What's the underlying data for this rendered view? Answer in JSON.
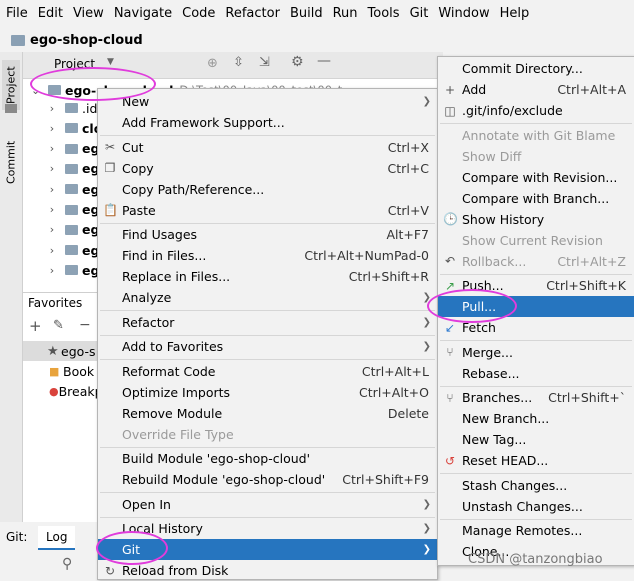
{
  "menubar": [
    "File",
    "Edit",
    "View",
    "Navigate",
    "Code",
    "Refactor",
    "Build",
    "Run",
    "Tools",
    "Git",
    "Window",
    "Help"
  ],
  "nav_title": "ego-shop-cloud",
  "left_tabs": {
    "project": "Project",
    "commit": "Commit"
  },
  "project_panel": {
    "header_label": "Project",
    "root_label": "ego-shop-cloud",
    "root_path": "D:\\Test\\00_Java\\00_test\\00_t",
    "children": [
      ".id",
      "clo",
      "eg",
      "eg",
      "eg",
      "eg",
      "eg",
      "eg",
      "eg"
    ]
  },
  "favorites": {
    "title": "Favorites",
    "items": [
      "ego-s",
      "Book",
      "Breakp"
    ]
  },
  "bottom": {
    "git_label": "Git:",
    "log_tab": "Log"
  },
  "context_menu": [
    {
      "label": "New",
      "sub": true
    },
    {
      "label": "Add Framework Support..."
    },
    {
      "sep": true
    },
    {
      "label": "Cut",
      "shortcut": "Ctrl+X",
      "icon": "scissors-icon"
    },
    {
      "label": "Copy",
      "shortcut": "Ctrl+C",
      "icon": "copy-icon"
    },
    {
      "label": "Copy Path/Reference..."
    },
    {
      "label": "Paste",
      "shortcut": "Ctrl+V",
      "icon": "paste-icon"
    },
    {
      "sep": true
    },
    {
      "label": "Find Usages",
      "shortcut": "Alt+F7"
    },
    {
      "label": "Find in Files...",
      "shortcut": "Ctrl+Alt+NumPad-0"
    },
    {
      "label": "Replace in Files...",
      "shortcut": "Ctrl+Shift+R"
    },
    {
      "label": "Analyze",
      "sub": true
    },
    {
      "sep": true
    },
    {
      "label": "Refactor",
      "sub": true
    },
    {
      "sep": true
    },
    {
      "label": "Add to Favorites",
      "sub": true
    },
    {
      "sep": true
    },
    {
      "label": "Reformat Code",
      "shortcut": "Ctrl+Alt+L"
    },
    {
      "label": "Optimize Imports",
      "shortcut": "Ctrl+Alt+O"
    },
    {
      "label": "Remove Module",
      "shortcut": "Delete"
    },
    {
      "label": "Override File Type",
      "disabled": true
    },
    {
      "sep": true
    },
    {
      "label": "Build Module 'ego-shop-cloud'"
    },
    {
      "label": "Rebuild Module 'ego-shop-cloud'",
      "shortcut": "Ctrl+Shift+F9"
    },
    {
      "sep": true
    },
    {
      "label": "Open In",
      "sub": true
    },
    {
      "sep": true
    },
    {
      "label": "Local History",
      "sub": true
    },
    {
      "label": "Git",
      "sub": true,
      "selected": true
    },
    {
      "label": "Reload from Disk",
      "icon": "reload-icon"
    }
  ],
  "git_submenu": [
    {
      "label": "Commit Directory..."
    },
    {
      "label": "Add",
      "shortcut": "Ctrl+Alt+A",
      "icon": "plus-icon"
    },
    {
      "label": ".git/info/exclude",
      "icon": "exclude-icon"
    },
    {
      "sep": true
    },
    {
      "label": "Annotate with Git Blame",
      "disabled": true
    },
    {
      "label": "Show Diff",
      "disabled": true
    },
    {
      "label": "Compare with Revision..."
    },
    {
      "label": "Compare with Branch..."
    },
    {
      "label": "Show History",
      "icon": "history-icon"
    },
    {
      "label": "Show Current Revision",
      "disabled": true
    },
    {
      "label": "Rollback...",
      "shortcut": "Ctrl+Alt+Z",
      "disabled": true,
      "icon": "rollback-icon"
    },
    {
      "sep": true
    },
    {
      "label": "Push...",
      "shortcut": "Ctrl+Shift+K",
      "icon": "push-icon"
    },
    {
      "label": "Pull...",
      "selected": true
    },
    {
      "label": "Fetch",
      "icon": "fetch-icon"
    },
    {
      "sep": true
    },
    {
      "label": "Merge...",
      "icon": "merge-icon"
    },
    {
      "label": "Rebase..."
    },
    {
      "sep": true
    },
    {
      "label": "Branches...",
      "shortcut": "Ctrl+Shift+`",
      "icon": "branch-icon"
    },
    {
      "label": "New Branch..."
    },
    {
      "label": "New Tag..."
    },
    {
      "label": "Reset HEAD...",
      "icon": "reset-icon"
    },
    {
      "sep": true
    },
    {
      "label": "Stash Changes..."
    },
    {
      "label": "Unstash Changes..."
    },
    {
      "sep": true
    },
    {
      "label": "Manage Remotes..."
    },
    {
      "label": "Clone..."
    }
  ],
  "watermark": "CSDN @tanzongbiao",
  "colors": {
    "selection": "#2675bf",
    "highlight_ellipse": "#e03cdc",
    "folder": "#8da2b5"
  }
}
